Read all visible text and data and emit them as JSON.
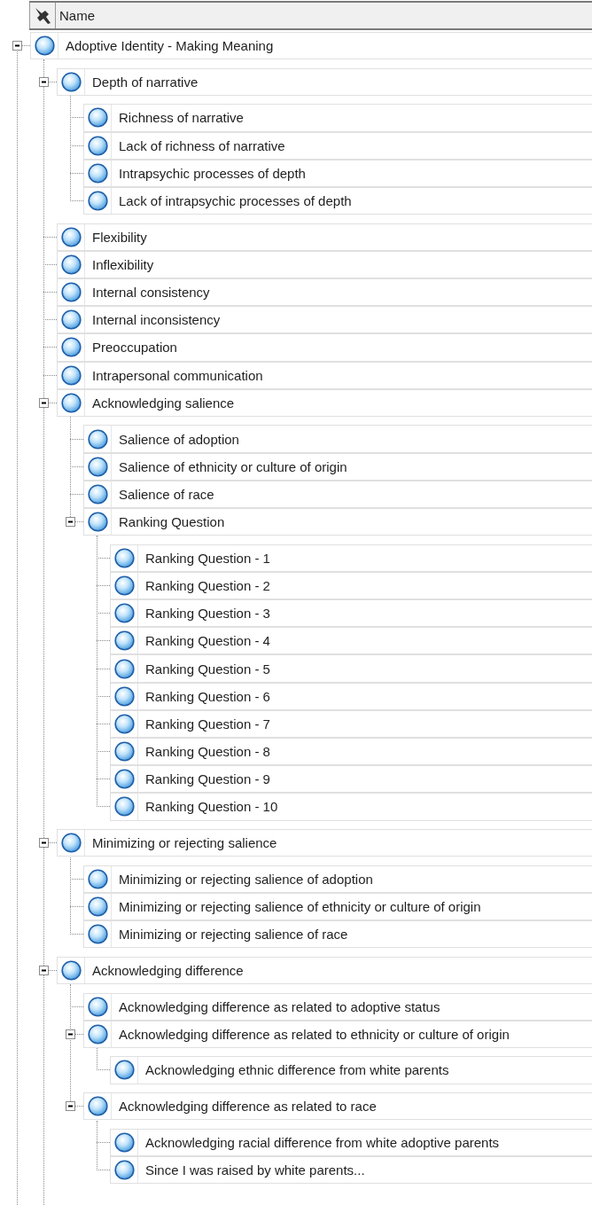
{
  "columns": [
    {
      "label": "Name"
    }
  ],
  "tree": [
    {
      "label": "Adoptive Identity - Making Meaning",
      "expanded": true,
      "children": [
        {
          "label": "Depth of narrative",
          "expanded": true,
          "children": [
            {
              "label": "Richness of narrative"
            },
            {
              "label": "Lack of richness of narrative"
            },
            {
              "label": "Intrapsychic processes of depth"
            },
            {
              "label": "Lack of intrapsychic processes of depth"
            }
          ]
        },
        {
          "label": "Flexibility"
        },
        {
          "label": "Inflexibility"
        },
        {
          "label": "Internal consistency"
        },
        {
          "label": "Internal inconsistency"
        },
        {
          "label": "Preoccupation"
        },
        {
          "label": "Intrapersonal communication"
        },
        {
          "label": "Acknowledging salience",
          "expanded": true,
          "children": [
            {
              "label": "Salience of adoption"
            },
            {
              "label": "Salience of ethnicity or culture of origin"
            },
            {
              "label": "Salience of race"
            },
            {
              "label": "Ranking Question",
              "expanded": true,
              "children": [
                {
                  "label": "Ranking Question - 1"
                },
                {
                  "label": "Ranking Question - 2"
                },
                {
                  "label": "Ranking Question - 3"
                },
                {
                  "label": "Ranking Question - 4"
                },
                {
                  "label": "Ranking Question - 5"
                },
                {
                  "label": "Ranking Question - 6"
                },
                {
                  "label": "Ranking Question - 7"
                },
                {
                  "label": "Ranking Question - 8"
                },
                {
                  "label": "Ranking Question - 9"
                },
                {
                  "label": "Ranking Question - 10"
                }
              ]
            }
          ]
        },
        {
          "label": "Minimizing or rejecting salience",
          "expanded": true,
          "children": [
            {
              "label": "Minimizing or rejecting salience of adoption"
            },
            {
              "label": "Minimizing or rejecting salience of ethnicity or culture of origin"
            },
            {
              "label": "Minimizing or rejecting salience of race"
            }
          ]
        },
        {
          "label": "Acknowledging difference",
          "expanded": true,
          "children": [
            {
              "label": "Acknowledging difference as related to adoptive status"
            },
            {
              "label": "Acknowledging difference as related to ethnicity or culture of origin",
              "expanded": true,
              "children": [
                {
                  "label": "Acknowledging ethnic difference from white parents"
                }
              ]
            },
            {
              "label": "Acknowledging difference as related to race",
              "expanded": true,
              "children": [
                {
                  "label": "Acknowledging racial difference from white adoptive parents"
                },
                {
                  "label": "Since I was raised by white parents..."
                }
              ]
            }
          ]
        }
      ]
    }
  ]
}
